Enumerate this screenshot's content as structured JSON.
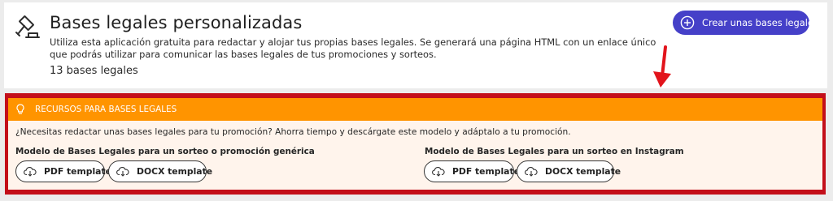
{
  "header": {
    "title": "Bases legales personalizadas",
    "description": "Utiliza esta aplicación gratuita para redactar y alojar tus propias bases legales. Se generará una página HTML con un enlace único que podrás utilizar para comunicar las bases legales de tus promociones y sorteos.",
    "count_text": "13 bases legales",
    "create_button_label": "Crear unas bases legales",
    "icon": "gavel-icon"
  },
  "resources": {
    "title": "RECURSOS PARA BASES LEGALES",
    "question": "¿Necesitas redactar unas bases legales para tu promoción? Ahorra tiempo y descárgate este modelo y adáptalo a tu promoción.",
    "columns": [
      {
        "title": "Modelo de Bases Legales para un sorteo o promoción genérica",
        "pdf_label": "PDF template",
        "docx_label": "DOCX template"
      },
      {
        "title": "Modelo de Bases Legales para un sorteo en Instagram",
        "pdf_label": "PDF template",
        "docx_label": "DOCX template"
      }
    ]
  },
  "colors": {
    "accent_button": "#4540c8",
    "resources_header": "#ff9400",
    "annotation_red": "#c30f1a",
    "resources_body": "#fff4ec"
  }
}
